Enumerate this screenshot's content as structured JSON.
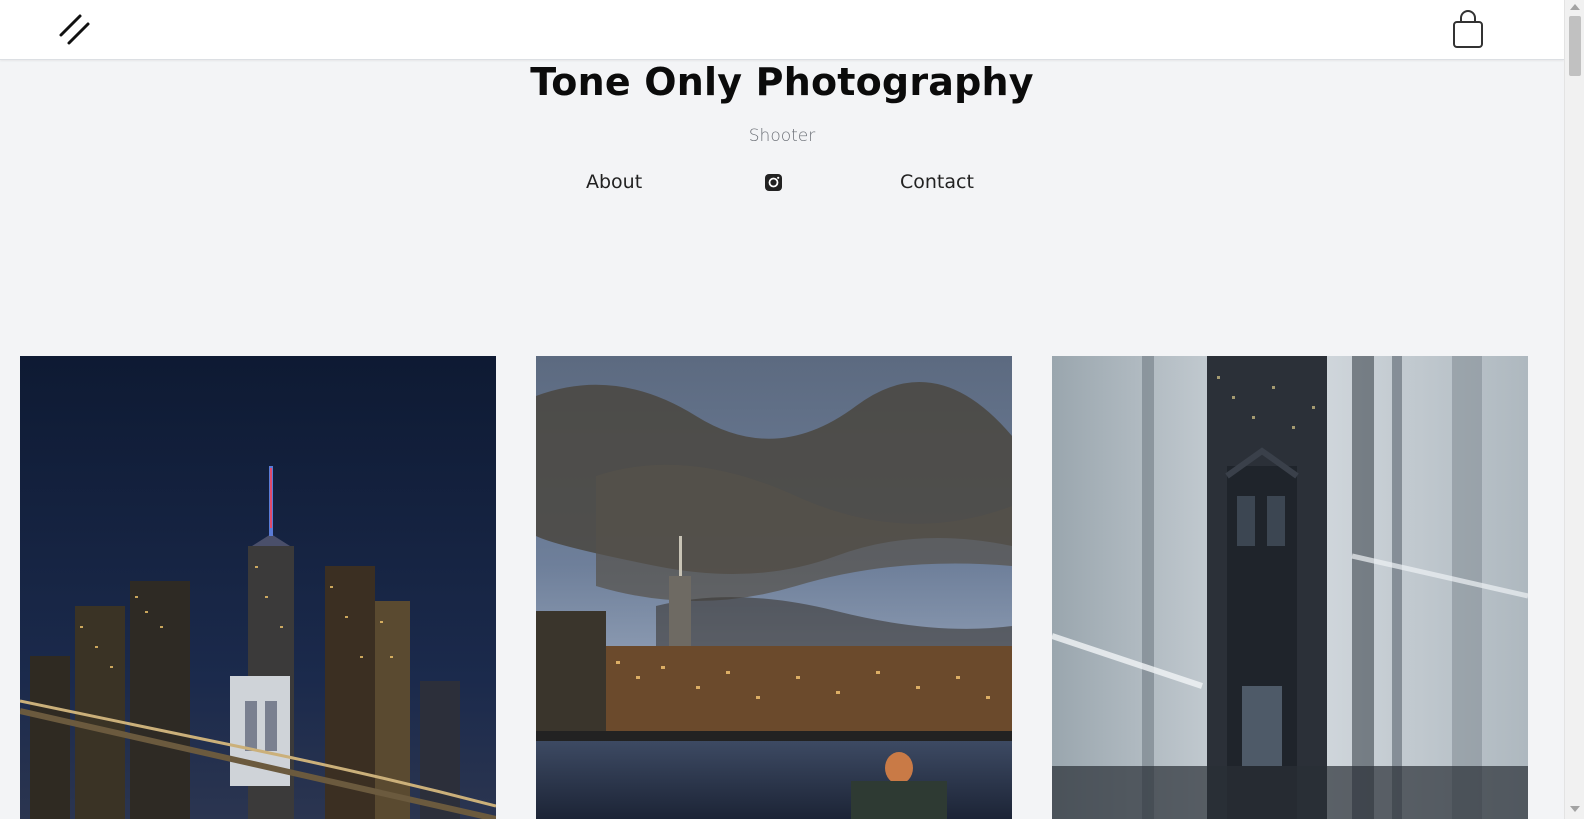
{
  "header": {
    "logo_icon": "double-slash-logo-icon",
    "cart_icon": "shopping-bag-icon"
  },
  "hero": {
    "title": "Tone Only Photography",
    "subtitle": "Shooter"
  },
  "nav": {
    "about_label": "About",
    "instagram_icon": "instagram-icon",
    "contact_label": "Contact"
  },
  "gallery": {
    "items": [
      {
        "subject": "night-skyline-with-bridge"
      },
      {
        "subject": "dusk-skyline-over-water"
      },
      {
        "subject": "bridge-through-glass-reflections"
      }
    ]
  },
  "colors": {
    "page_background": "#f3f4f6",
    "header_background": "#ffffff",
    "title_text": "#0b0b0b",
    "subtitle_text": "#6b6f76"
  }
}
